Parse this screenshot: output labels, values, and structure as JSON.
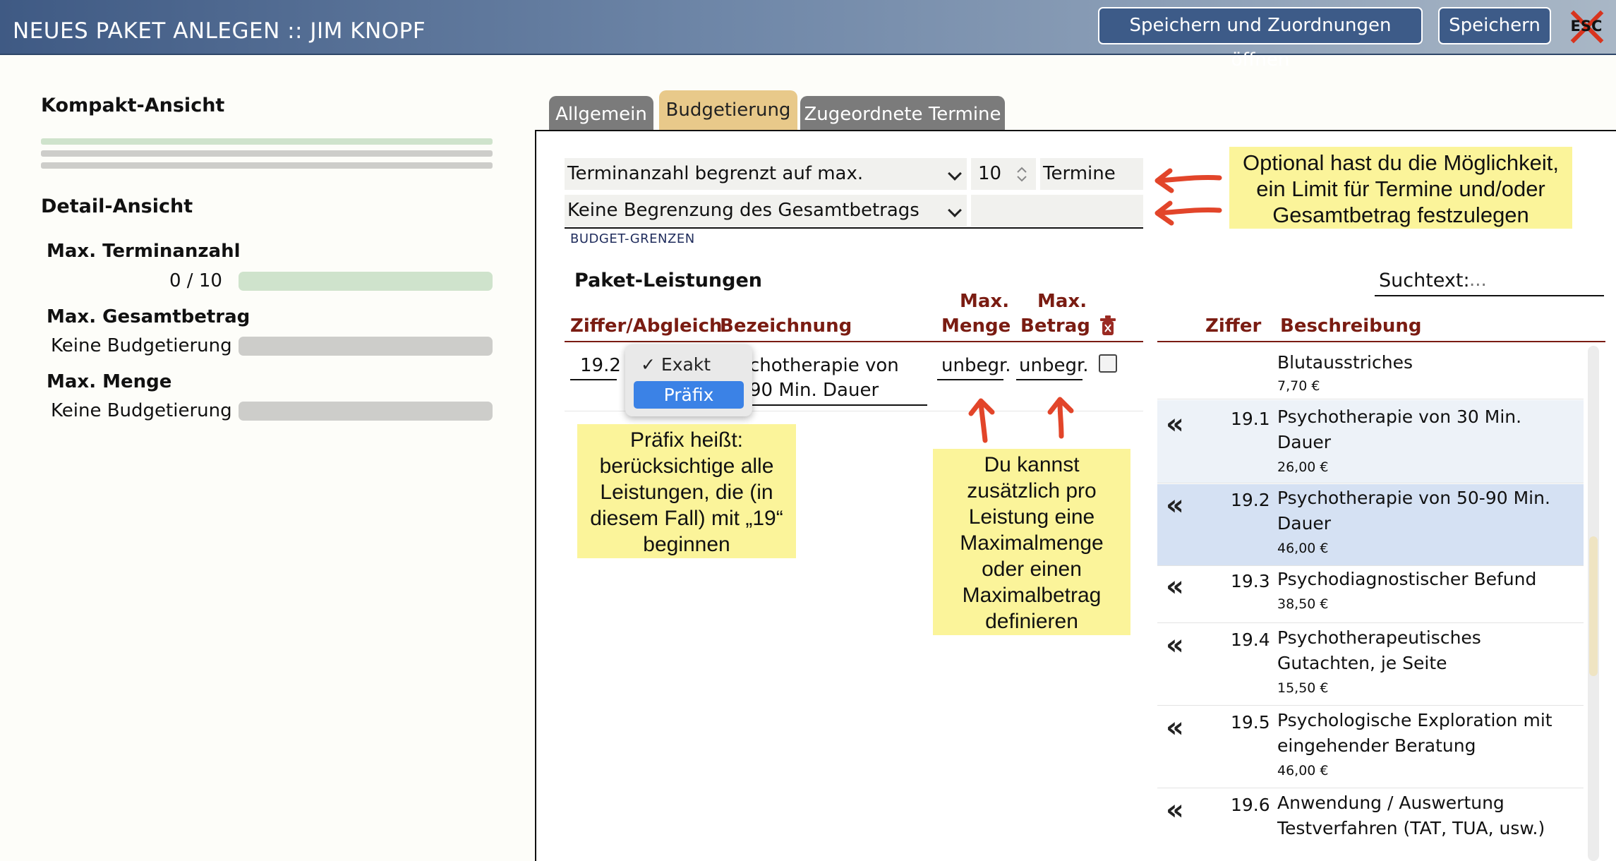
{
  "header": {
    "title": "NEUES PAKET ANLEGEN :: JIM KNOPF",
    "save_and_open_label": "Speichern und Zuordnungen öffnen",
    "save_label": "Speichern",
    "esc_label": "ESC"
  },
  "sidebar": {
    "compact_title": "Kompakt-Ansicht",
    "detail_title": "Detail-Ansicht",
    "max_termine_label": "Max. Terminanzahl",
    "max_termine_value": "0 / 10",
    "max_termine_progress": 1.0,
    "max_betrag_label": "Max. Gesamtbetrag",
    "max_betrag_value": "Keine Budgetierung",
    "max_menge_label": "Max. Menge",
    "max_menge_value": "Keine Budgetierung"
  },
  "tabs": [
    {
      "label": "Allgemein",
      "active": false
    },
    {
      "label": "Budgetierung",
      "active": true
    },
    {
      "label": "Zugeordnete Termine",
      "active": false
    }
  ],
  "budget": {
    "termin_select": "Terminanzahl begrenzt auf max.",
    "termin_count": "10",
    "termin_unit": "Termine",
    "betrag_select": "Keine Begrenzung des Gesamtbetrags",
    "section_label": "BUDGET-GRENZEN"
  },
  "notes": {
    "optional": "Optional hast du die Möglichkeit, ein Limit für Termine und/oder Gesamtbetrag festzulegen",
    "praefix": "Präfix heißt: berücksichtige alle Leistungen, die (in diesem Fall) mit „19“ beginnen",
    "maxmenge": "Du kannst zusätzlich pro Leistung eine Maximalmenge oder einen Maximalbetrag definieren"
  },
  "paket": {
    "title": "Paket-Leistungen",
    "col_ziffer": "Ziffer/Abgleich",
    "col_bezeichnung": "Bezeichnung",
    "col_max": "Max.",
    "col_menge": "Menge",
    "col_betrag": "Betrag",
    "row": {
      "ziffer": "19.2",
      "bezeichnung_line1": "chotherapie von",
      "bezeichnung_line2": "90 Min. Dauer",
      "menge": "unbegr.",
      "betrag": "unbegr."
    },
    "dropdown": {
      "option_exakt": "✓ Exakt",
      "option_praefix": "Präfix"
    }
  },
  "search": {
    "label": "Suchtext:",
    "placeholder": "..."
  },
  "catalog": {
    "col_ziffer": "Ziffer",
    "col_beschreibung": "Beschreibung",
    "items": [
      {
        "num": "",
        "desc": "Blutausstriches",
        "price": "7,70 €"
      },
      {
        "num": "19.1",
        "desc": "Psychotherapie von 30 Min. Dauer",
        "price": "26,00 €"
      },
      {
        "num": "19.2",
        "desc": "Psychotherapie von 50-90 Min. Dauer",
        "price": "46,00 €"
      },
      {
        "num": "19.3",
        "desc": "Psychodiagnostischer Befund",
        "price": "38,50 €"
      },
      {
        "num": "19.4",
        "desc": "Psychotherapeutisches Gutachten, je Seite",
        "price": "15,50 €"
      },
      {
        "num": "19.5",
        "desc": "Psychologische Exploration mit eingehender Beratung",
        "price": "46,00 €"
      },
      {
        "num": "19.6",
        "desc": "Anwendung / Auswertung Testverfahren (TAT, TUA, usw.)",
        "price": ""
      }
    ]
  }
}
